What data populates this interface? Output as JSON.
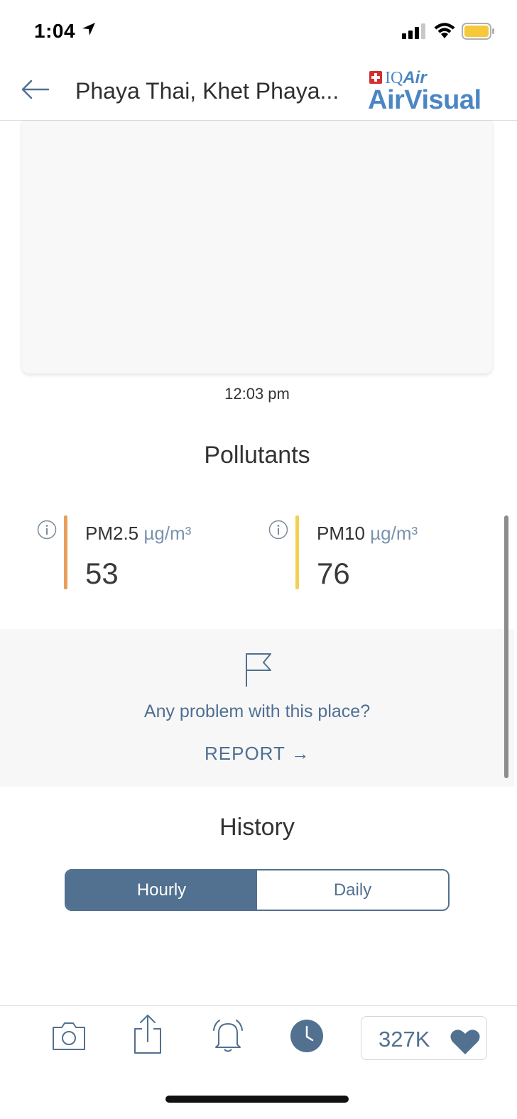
{
  "status_bar": {
    "time": "1:04"
  },
  "header": {
    "title": "Phaya Thai, Khet Phaya...",
    "logo_top": "IQAir",
    "logo_iq": "IQ",
    "logo_air": "Air",
    "logo_main": "AirVisual"
  },
  "card": {
    "time": "12:03 pm"
  },
  "pollutants": {
    "title": "Pollutants",
    "items": [
      {
        "name": "PM2.5",
        "unit": "µg/m³",
        "value": "53",
        "color": "#e8a05c"
      },
      {
        "name": "PM10",
        "unit": "µg/m³",
        "value": "76",
        "color": "#f3d04f"
      }
    ]
  },
  "report": {
    "question": "Any problem with this place?",
    "button": "REPORT →"
  },
  "history": {
    "title": "History",
    "tabs": [
      {
        "label": "Hourly",
        "active": true
      },
      {
        "label": "Daily",
        "active": false
      }
    ]
  },
  "toolbar": {
    "likes": "327K"
  },
  "colors": {
    "accent": "#52708f",
    "link": "#4f6f92",
    "brand": "#4b86c4"
  },
  "icons": [
    "location-arrow-icon",
    "signal-icon",
    "wifi-icon",
    "battery-icon",
    "back-arrow-icon",
    "info-icon",
    "flag-icon",
    "camera-icon",
    "share-icon",
    "bell-icon",
    "clock-icon",
    "heart-icon"
  ]
}
